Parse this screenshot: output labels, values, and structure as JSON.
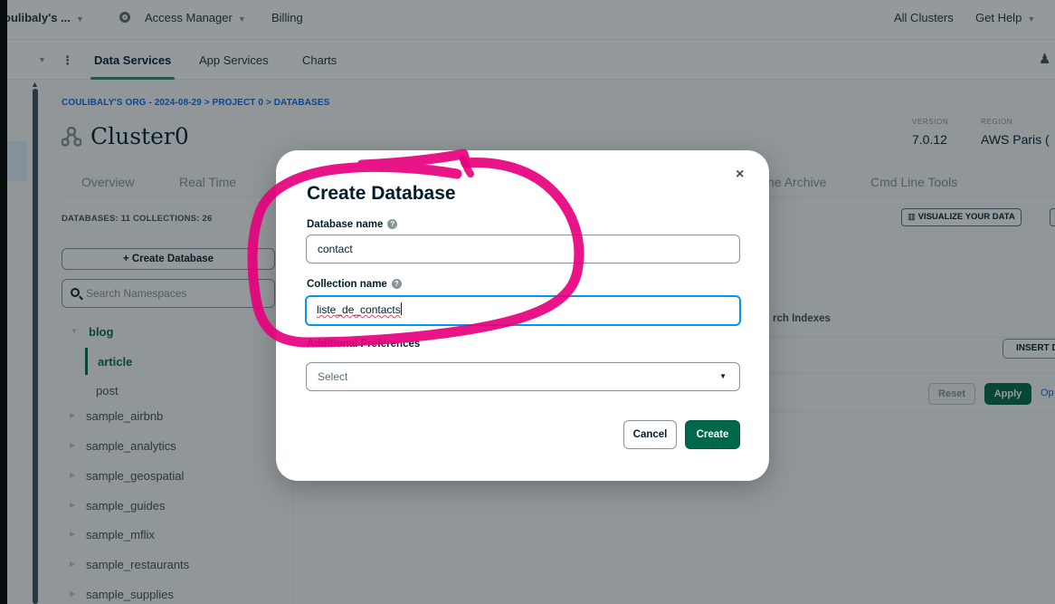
{
  "topbar": {
    "org": "oulibaly's ...",
    "access_manager": "Access Manager",
    "billing": "Billing",
    "all_clusters": "All Clusters",
    "get_help": "Get Help"
  },
  "navbar": {
    "tabs": [
      "Data Services",
      "App Services",
      "Charts"
    ]
  },
  "breadcrumb": "COULIBALY'S ORG - 2024-08-29 > PROJECT 0 > DATABASES",
  "cluster": {
    "name": "Cluster0",
    "version_label": "VERSION",
    "version": "7.0.12",
    "region_label": "REGION",
    "region": "AWS Paris ("
  },
  "tabs": [
    "Overview",
    "Real Time",
    "ne Archive",
    "Cmd Line Tools"
  ],
  "counts": "DATABASES: 11   COLLECTIONS: 26",
  "visualize_label": "VISUALIZE YOUR DATA",
  "sidebar": {
    "create_label": "+ Create Database",
    "search_placeholder": "Search Namespaces",
    "items": [
      {
        "label": "blog"
      },
      {
        "label": "article"
      },
      {
        "label": "post"
      },
      {
        "label": "sample_airbnb"
      },
      {
        "label": "sample_analytics"
      },
      {
        "label": "sample_geospatial"
      },
      {
        "label": "sample_guides"
      },
      {
        "label": "sample_mflix"
      },
      {
        "label": "sample_restaurants"
      },
      {
        "label": "sample_supplies"
      }
    ]
  },
  "main": {
    "search_indexes_label": "rch Indexes",
    "insert_label": "INSERT DO",
    "reset_label": "Reset",
    "apply_label": "Apply",
    "options_label": "Op"
  },
  "modal": {
    "title": "Create Database",
    "close": "×",
    "db_name_label": "Database name",
    "db_name_value": "contact",
    "coll_name_label": "Collection name",
    "coll_name_value": "liste_de_contacts",
    "prefs_label": "Additional Preferences",
    "prefs_value": "Select",
    "cancel_label": "Cancel",
    "create_label": "Create"
  },
  "colors": {
    "accent_green": "#00684a",
    "link_blue": "#016bf8",
    "annotation_pink": "#e6007e"
  }
}
